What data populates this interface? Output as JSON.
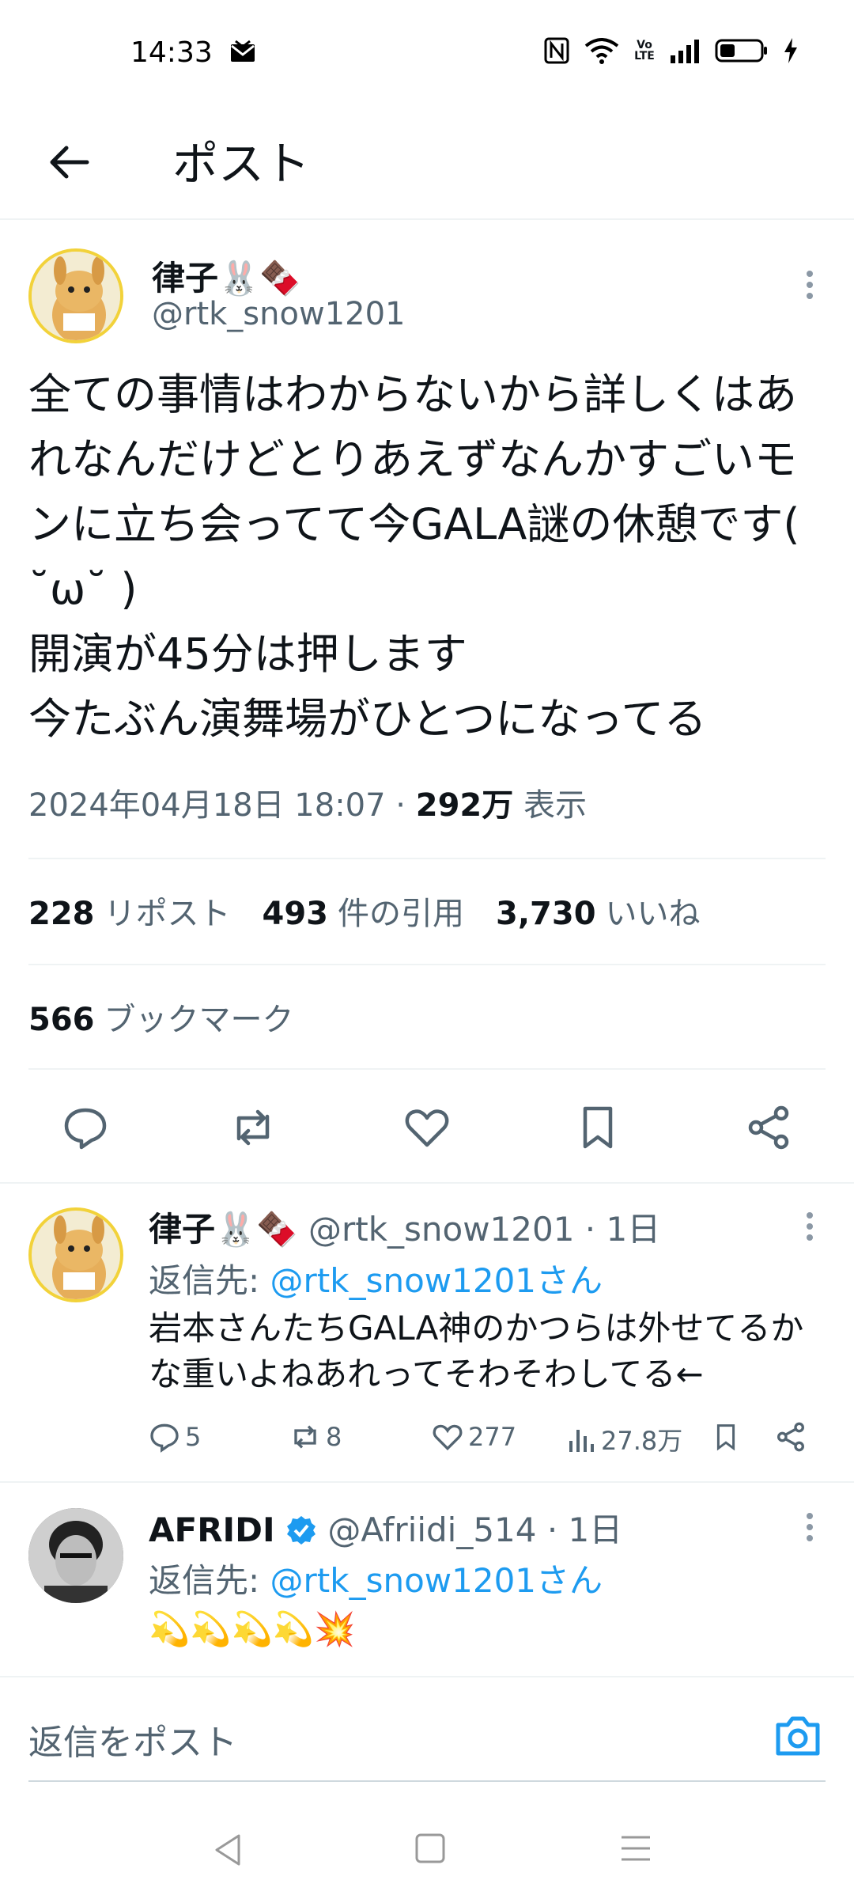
{
  "status_bar": {
    "time": "14:33",
    "icons": [
      "mail-icon",
      "nfc-icon",
      "wifi-icon",
      "volte-icon",
      "signal-icon",
      "battery-icon",
      "charging-icon"
    ],
    "volte_label": "Vo LTE"
  },
  "header": {
    "title": "ポスト"
  },
  "tweet": {
    "name": "律子🐰🍫",
    "handle": "@rtk_snow1201",
    "text": "全ての事情はわからないから詳しくはあれなんだけどとりあえずなんかすごいモンに立ち会ってて今GALA謎の休憩です( ˘ω˘ )\n開演が45分は押します\n今たぶん演舞場がひとつになってる",
    "timestamp": "2024年04月18日 18:07 · ",
    "views": "292万",
    "views_label": " 表示",
    "reposts": "228",
    "reposts_label": "リポスト",
    "quotes": "493",
    "quotes_label": "件の引用",
    "likes": "3,730",
    "likes_label": "いいね",
    "bookmarks": "566",
    "bookmarks_label": "ブックマーク"
  },
  "replies": [
    {
      "name": "律子🐰🍫",
      "handle": "@rtk_snow1201 · 1日",
      "reply_to_label": "返信先: ",
      "reply_to": "@rtk_snow1201さん",
      "text": "岩本さんたちGALA神のかつらは外せてるかな重いよねあれってそわそわしてる←",
      "comments": "5",
      "reposts": "8",
      "likes": "277",
      "views": "27.8万"
    },
    {
      "name": "AFRIDI",
      "handle": "@Afriidi_514 · 1日",
      "reply_to_label": "返信先: ",
      "reply_to": "@rtk_snow1201さん",
      "text": "💫💫💫💫💥"
    }
  ],
  "compose": {
    "placeholder": "返信をポスト"
  },
  "colors": {
    "accent": "#1d9bf0",
    "muted": "#536471",
    "text": "#0f1419"
  }
}
